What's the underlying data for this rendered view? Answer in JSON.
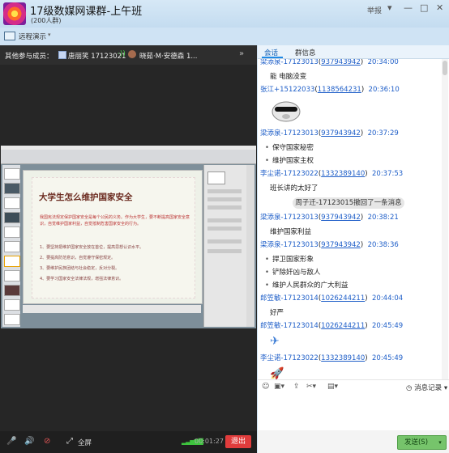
{
  "window": {
    "title": "17级数媒网课群-上午班",
    "subtitle": "(200人群)",
    "report_label": "举报",
    "controls": [
      "▾",
      "—",
      "□",
      "✕"
    ]
  },
  "toolbar": {
    "share_label": "远程演示",
    "share_arrow": "▾"
  },
  "members": {
    "label": "其他参与成员：",
    "list": [
      {
        "name": "唐丽笑 17123021",
        "signal": "·))"
      },
      {
        "name": "晓茹·M·安德森 1..."
      }
    ],
    "more": "»"
  },
  "slide": {
    "title": "大学生怎么维护国家安全",
    "subtitle": "我国宪法规定保护国家安全是每个公民的义务。作为大学生，要不断提高国家安全意识，自觉维护国家利益，自觉抵制危害国家安全的行为。",
    "points": [
      "1、要坚持把维护国家安全放在首位，提高思想认识水平。",
      "2、要提高防范意识，自觉遵守保密规定。",
      "3、要维护民族团结与社会稳定，反对分裂。",
      "4、要学习国家安全法律法规，增强法律意识。"
    ]
  },
  "call": {
    "fullscreen_label": "全屏",
    "timer": "00:01:27",
    "signal": "▂▃▅▆▇",
    "exit_label": "退出"
  },
  "side_tabs": [
    {
      "label": "会话",
      "active": true
    },
    {
      "label": "群信息",
      "active": false
    }
  ],
  "chat": [
    {
      "type": "head",
      "sender": "梁添泉-17123013",
      "uid": "937943942",
      "time": "20:34:00"
    },
    {
      "type": "body",
      "text": "能 电脑没变"
    },
    {
      "type": "head",
      "sender": "张江+15122033",
      "uid": "1138564231",
      "time": "20:36:10"
    },
    {
      "type": "sticker",
      "text": "[表情]"
    },
    {
      "type": "head",
      "sender": "梁添泉-17123013",
      "uid": "937943942",
      "time": "20:37:29"
    },
    {
      "type": "bullet",
      "text": "保守国家秘密"
    },
    {
      "type": "bullet",
      "text": "维护国家主权"
    },
    {
      "type": "head",
      "sender": "李尘诺-17123022",
      "uid": "1332389140",
      "time": "20:37:53"
    },
    {
      "type": "body",
      "text": "班长讲的太好了"
    },
    {
      "type": "system",
      "text": "周子迁-17123015撤回了一条消息"
    },
    {
      "type": "head",
      "sender": "梁添泉-17123013",
      "uid": "937943942",
      "time": "20:38:21"
    },
    {
      "type": "body",
      "text": "维护国家利益"
    },
    {
      "type": "head",
      "sender": "梁添泉-17123013",
      "uid": "937943942",
      "time": "20:38:36"
    },
    {
      "type": "bullet",
      "text": "捍卫国家形象"
    },
    {
      "type": "bullet",
      "text": "铲除奸凶与敌人"
    },
    {
      "type": "bullet",
      "text": "维护人民群众的广大利益"
    },
    {
      "type": "head",
      "sender": "郎笠敏-17123014",
      "uid": "1026244211",
      "time": "20:44:04"
    },
    {
      "type": "body",
      "text": "好严"
    },
    {
      "type": "head",
      "sender": "郎笠敏-17123014",
      "uid": "1026244211",
      "time": "20:45:49"
    },
    {
      "type": "sticker",
      "text": "✈"
    },
    {
      "type": "head",
      "sender": "李尘诺-17123022",
      "uid": "1332389140",
      "time": "20:45:49"
    },
    {
      "type": "sticker",
      "text": "🚀"
    }
  ],
  "composer": {
    "icons": [
      "☺",
      "▣▾",
      "⇪",
      "✂▾",
      "▤▾"
    ],
    "history_label": "消息记录",
    "history_arrow": "▾",
    "send_label": "发送(S)",
    "send_arrow": "▾"
  },
  "colors": {
    "link": "#1e5ec8",
    "exit": "#e03c3c",
    "send": "#76c46b"
  }
}
